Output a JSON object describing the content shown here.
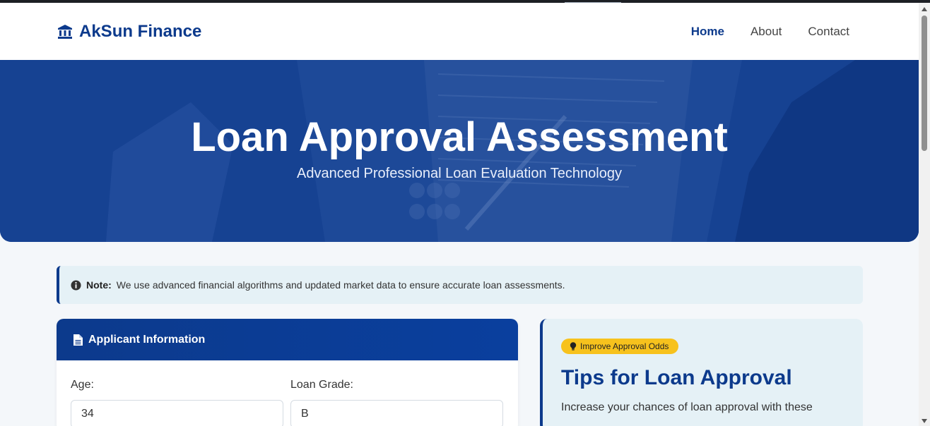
{
  "nav": {
    "brand": "AkSun Finance",
    "links": [
      {
        "label": "Home",
        "active": true
      },
      {
        "label": "About",
        "active": false
      },
      {
        "label": "Contact",
        "active": false
      }
    ]
  },
  "hero": {
    "title": "Loan Approval Assessment",
    "subtitle": "Advanced Professional Loan Evaluation Technology"
  },
  "note": {
    "label": "Note:",
    "text": "We use advanced financial algorithms and updated market data to ensure accurate loan assessments."
  },
  "applicant": {
    "heading": "Applicant Information",
    "fields": [
      {
        "label": "Age:",
        "value": "34"
      },
      {
        "label": "Loan Grade:",
        "value": "B"
      }
    ]
  },
  "tips": {
    "badge": "Improve Approval Odds",
    "heading": "Tips for Loan Approval",
    "intro": "Increase your chances of loan approval with these"
  },
  "colors": {
    "brand": "#0c3a8c",
    "accent_badge": "#f7c21d",
    "note_bg": "#e5f1f6"
  },
  "icons": {
    "brand": "bank-icon",
    "note": "info-circle-icon",
    "card": "file-icon",
    "badge": "lightbulb-icon"
  }
}
